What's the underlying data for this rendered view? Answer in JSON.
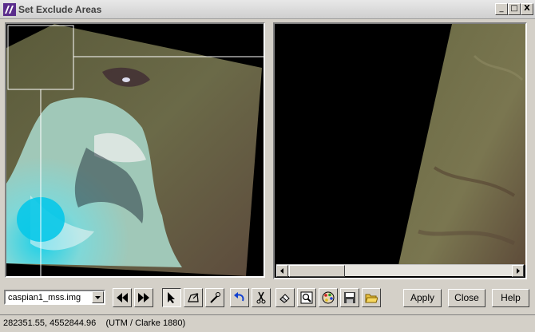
{
  "window": {
    "title": "Set Exclude Areas"
  },
  "controls": {
    "minimize": "_",
    "maximize": "□",
    "close": "X"
  },
  "image_select": {
    "value": "caspian1_mss.img"
  },
  "buttons": {
    "apply": "Apply",
    "close": "Close",
    "help": "Help"
  },
  "status": {
    "coordinates": "282351.55, 4552844.96",
    "projection": "(UTM / Clarke 1880)"
  },
  "icons": [
    "rewind-icon",
    "fast-forward-icon",
    "arrow-select-icon",
    "polygon-icon",
    "magic-wand-icon",
    "undo-icon",
    "cut-icon",
    "erase-icon",
    "zoom-icon",
    "palette-icon",
    "save-icon",
    "open-folder-icon"
  ]
}
